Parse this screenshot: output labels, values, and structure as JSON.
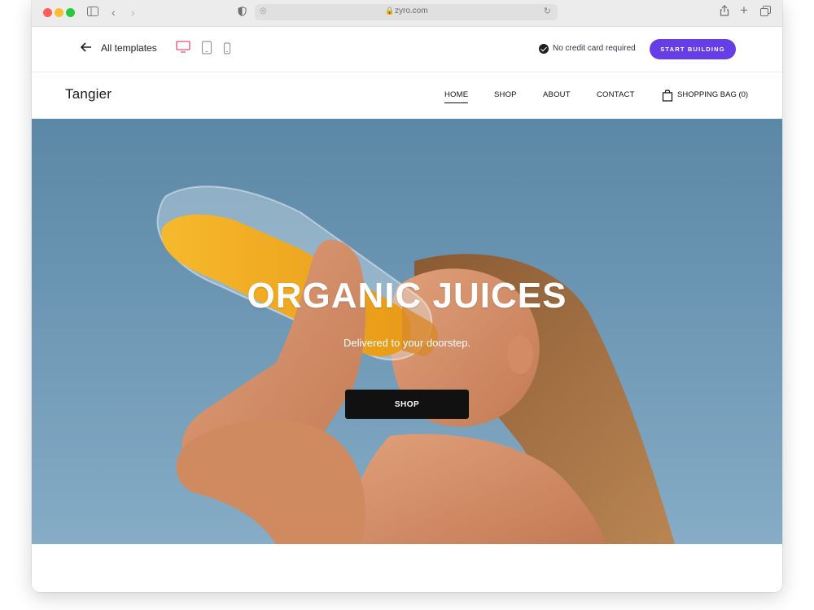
{
  "browser": {
    "url": "zyro.com"
  },
  "editor_bar": {
    "back_label": "All templates",
    "no_credit_card": "No credit card required",
    "start_button": "START BUILDING",
    "active_device": "desktop"
  },
  "site": {
    "logo": "Tangier",
    "nav": [
      {
        "label": "HOME",
        "active": true
      },
      {
        "label": "SHOP",
        "active": false
      },
      {
        "label": "ABOUT",
        "active": false
      },
      {
        "label": "CONTACT",
        "active": false
      }
    ],
    "bag_label": "SHOPPING BAG (0)"
  },
  "hero": {
    "title": "ORGANIC JUICES",
    "subtitle": "Delivered to your doorstep.",
    "button": "SHOP"
  },
  "colors": {
    "accent": "#673de6",
    "active_device": "#e8506a",
    "hero_button": "#111111"
  }
}
